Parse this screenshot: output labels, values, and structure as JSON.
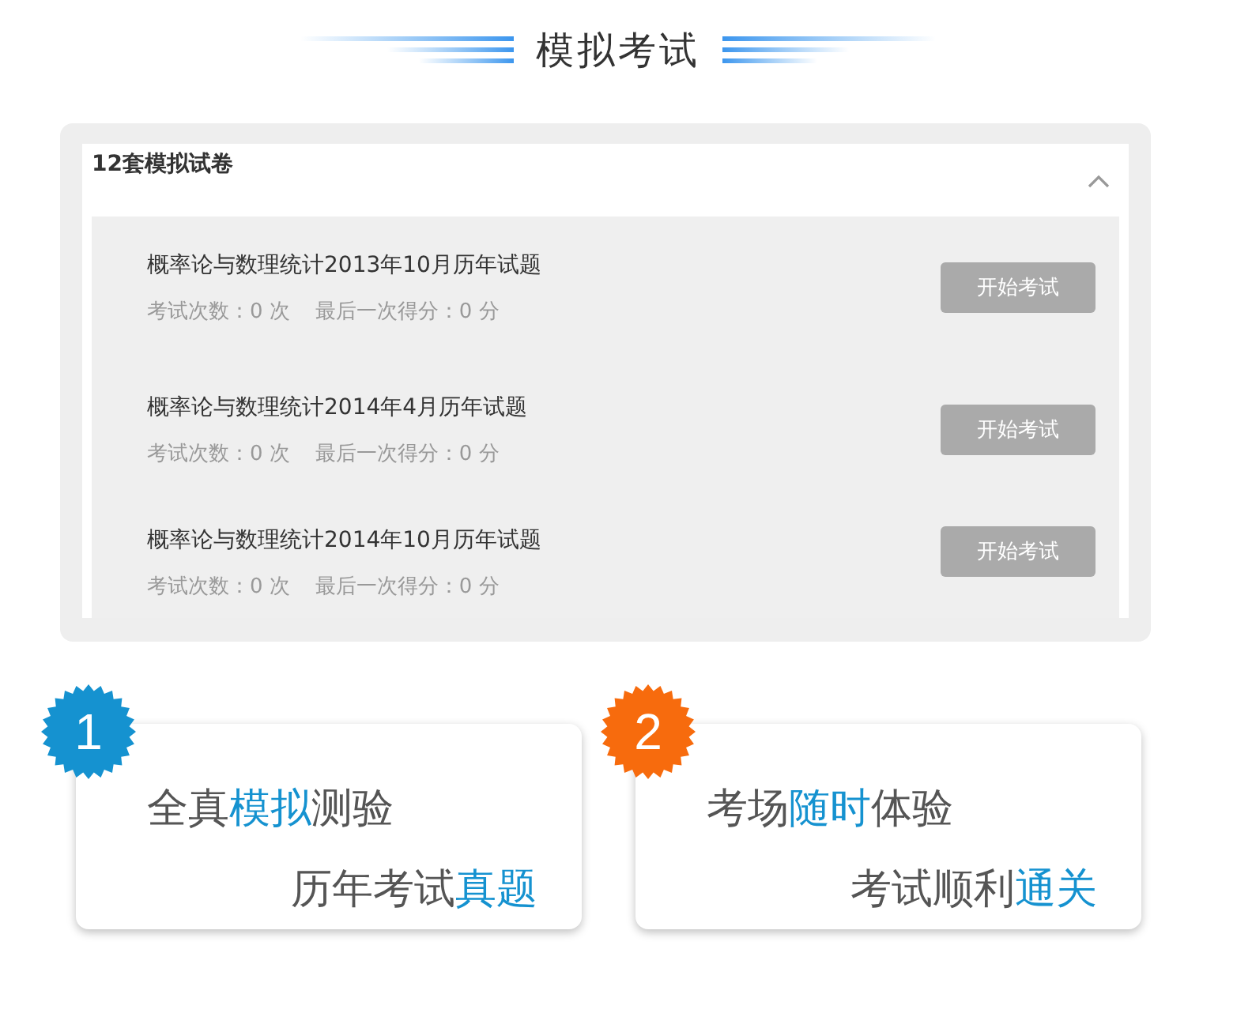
{
  "title": "模拟考试",
  "panel": {
    "title": "12套模拟试卷",
    "expanded": true,
    "exams": [
      {
        "name": "概率论与数理统计2013年10月历年试题",
        "attempts": "考试次数：0 次",
        "last_score": "最后一次得分：0 分",
        "button": "开始考试"
      },
      {
        "name": "概率论与数理统计2014年4月历年试题",
        "attempts": "考试次数：0 次",
        "last_score": "最后一次得分：0 分",
        "button": "开始考试"
      },
      {
        "name": "概率论与数理统计2014年10月历年试题",
        "attempts": "考试次数：0 次",
        "last_score": "最后一次得分：0 分",
        "button": "开始考试"
      }
    ]
  },
  "features": [
    {
      "badge": "1",
      "color": "#1592d0",
      "lines": [
        [
          {
            "text": "全真",
            "highlight": false
          },
          {
            "text": "模拟",
            "highlight": true
          },
          {
            "text": "测验",
            "highlight": false
          }
        ],
        [
          {
            "text": "历年考试",
            "highlight": false
          },
          {
            "text": "真题",
            "highlight": true
          }
        ]
      ]
    },
    {
      "badge": "2",
      "color": "#f76b0d",
      "lines": [
        [
          {
            "text": "考场",
            "highlight": false
          },
          {
            "text": "随时",
            "highlight": true
          },
          {
            "text": "体验",
            "highlight": false
          }
        ],
        [
          {
            "text": "考试顺利",
            "highlight": false
          },
          {
            "text": "通关",
            "highlight": true
          }
        ]
      ]
    }
  ]
}
